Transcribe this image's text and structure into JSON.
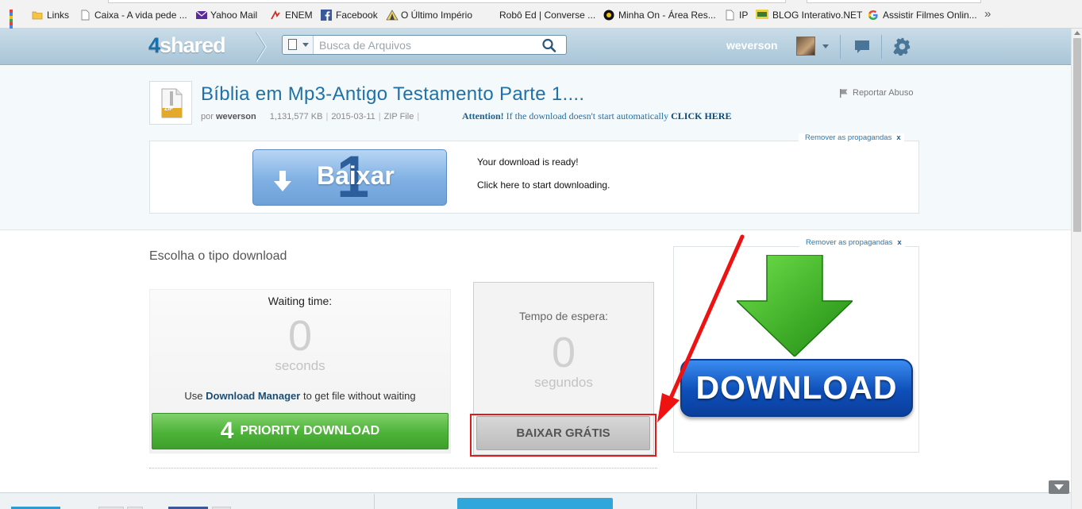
{
  "bookmarks": [
    {
      "label": "",
      "icon": "apps-grid-icon"
    },
    {
      "label": "Links",
      "icon": "folder-icon"
    },
    {
      "label": "Caixa - A vida pede ...",
      "icon": "page-icon"
    },
    {
      "label": "Yahoo Mail",
      "icon": "envelope-icon"
    },
    {
      "label": "ENEM",
      "icon": "enem-icon"
    },
    {
      "label": "Facebook",
      "icon": "facebook-icon"
    },
    {
      "label": "O Último Império",
      "icon": "empire-icon"
    },
    {
      "label": "Robô Ed | Converse ...",
      "icon": "blank-icon"
    },
    {
      "label": "Minha On - Área Res...",
      "icon": "minha-on-icon"
    },
    {
      "label": "IP",
      "icon": "page-icon"
    },
    {
      "label": "BLOG Interativo.NET",
      "icon": "blog-icon"
    },
    {
      "label": "Assistir Filmes Onlin...",
      "icon": "google-icon"
    }
  ],
  "bookmarks_more": "»",
  "header": {
    "logo_number": "4",
    "logo_text": "shared",
    "search_placeholder": "Busca de Arquivos",
    "username": "weverson"
  },
  "file": {
    "title": "Bíblia em Mp3-Antigo Testamento Parte 1....",
    "by_label": "por",
    "uploader": "weverson",
    "size": "1,131,577 KB",
    "date": "2015-03-11",
    "type": "ZIP File",
    "icon_label": "ZIP",
    "attention_label": "Attention!",
    "attention_text": "If the download doesn't start automatically",
    "attention_link": "CLICK HERE",
    "report_label": "Reportar Abuso"
  },
  "ad1": {
    "remove_ads": "Remover as propagandas",
    "remove_x": "x",
    "button_number": "1",
    "button_label": "Baixar",
    "ready_line1": "Your download is ready!",
    "ready_line2": "Click here to start downloading."
  },
  "main": {
    "choose_label": "Escolha o tipo download",
    "premium": {
      "wait_label": "Waiting time:",
      "wait_value": "0",
      "wait_unit": "seconds",
      "dm_prefix": "Use",
      "dm_link": "Download Manager",
      "dm_suffix": "to get file without waiting",
      "button_icon": "4",
      "button_label": "PRIORITY DOWNLOAD"
    },
    "free": {
      "wait_label": "Tempo de espera:",
      "wait_value": "0",
      "wait_unit": "segundos",
      "button_label": "BAIXAR GRÁTIS"
    }
  },
  "ad2": {
    "remove_ads": "Remover as propagandas",
    "remove_x": "x",
    "banner_label": "DOWNLOAD"
  },
  "colors": {
    "accent_blue": "#1f71a6",
    "priority_green": "#4db338",
    "highlight_red": "#e3181b",
    "download_blue": "#0e4fb9"
  }
}
